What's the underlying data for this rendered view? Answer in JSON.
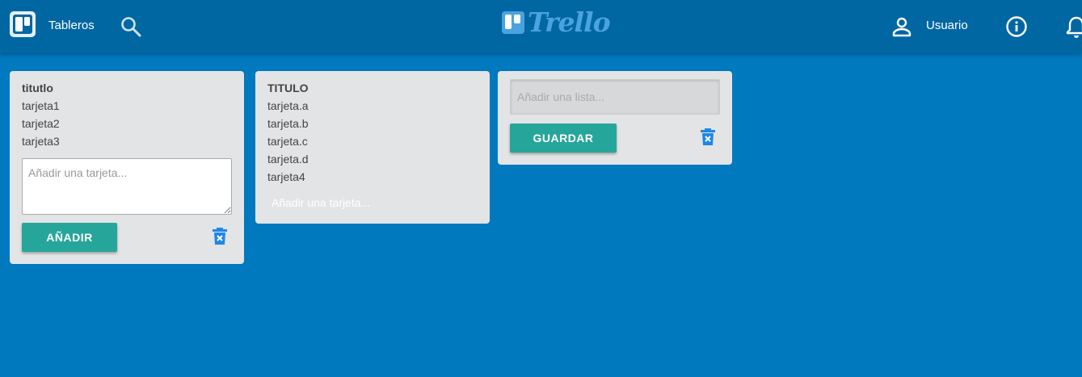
{
  "header": {
    "boards_label": "Tableros",
    "logo_text": "Trello",
    "user_label": "Usuario",
    "icons": [
      "boards-icon",
      "search-icon",
      "user-icon",
      "info-icon",
      "bell-icon"
    ]
  },
  "colors": {
    "background": "#0079bf",
    "header": "#0067a3",
    "list": "#e2e4e6",
    "button": "#26a69a",
    "trash": "#1e88e5"
  },
  "lists": [
    {
      "title": "titutlo",
      "cards": [
        "tarjeta1",
        "tarjeta2",
        "tarjeta3"
      ],
      "textarea_placeholder": "Añadir una tarjeta...",
      "add_button": "AÑADIR"
    },
    {
      "title": "TITULO",
      "cards": [
        "tarjeta.a",
        "tarjeta.b",
        "tarjeta.c",
        "tarjeta.d",
        "tarjeta4"
      ],
      "add_card_link": "Añadir una tarjeta..."
    }
  ],
  "new_list": {
    "placeholder": "Añadir una lista...",
    "save_button": "GUARDAR"
  }
}
